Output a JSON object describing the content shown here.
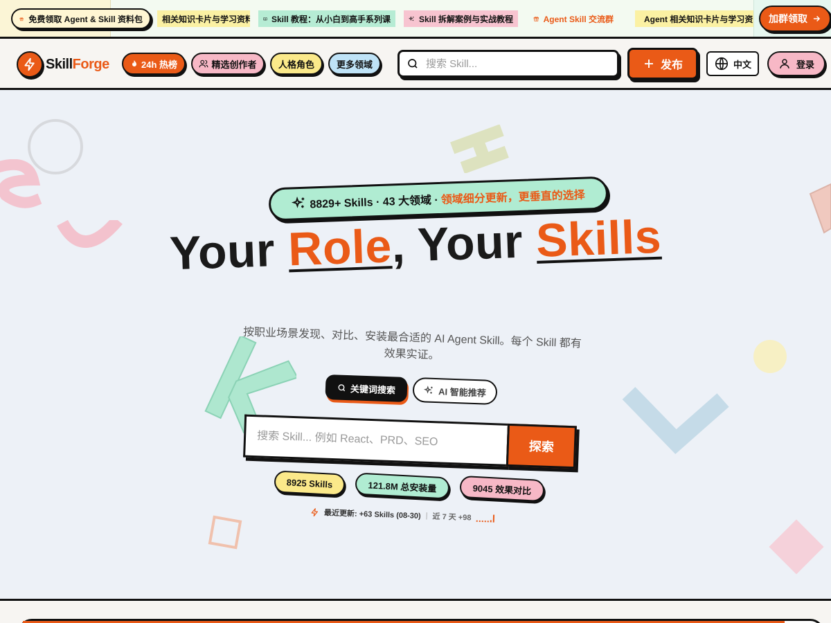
{
  "announcement": {
    "free_label": "免费领取 Agent & Skill 资料包",
    "items": [
      {
        "label": "相关知识卡片与学习资料",
        "icon": "none",
        "bg": "#fbf1a3",
        "color": "#111111"
      },
      {
        "label": "Skill 教程：从小白到高手系列课",
        "icon": "book-icon",
        "bg": "#b6ecd4",
        "color": "#111111"
      },
      {
        "label": "Skill 拆解案例与实战教程",
        "icon": "sparkles-icon",
        "bg": "#f7c4d0",
        "color": "#111111"
      },
      {
        "label": "Agent Skill 交流群",
        "icon": "gift-icon",
        "bg": "transparent",
        "color": "#ea5a17"
      },
      {
        "label": "Agent 相关知识卡片与学习资",
        "icon": "gift-icon",
        "bg": "#fbf1a3",
        "color": "#111111"
      }
    ],
    "cta_label": "加群领取"
  },
  "header": {
    "logo_part1": "Skill",
    "logo_part2": "Forge",
    "nav": [
      {
        "label": "24h 热榜",
        "icon": "fire-icon"
      },
      {
        "label": "精选创作者",
        "icon": "users-icon"
      },
      {
        "label": "人格角色",
        "icon": "none"
      },
      {
        "label": "更多领域",
        "icon": "none"
      }
    ],
    "search_placeholder": "搜索 Skill...",
    "publish_label": "发布",
    "lang_label": "中文",
    "login_label": "登录"
  },
  "hero": {
    "badge_main": "8829+ Skills · 43 大领域 · ",
    "badge_highlight": "领域细分更新，更垂直的选择",
    "title": {
      "p1": "Your ",
      "accent1": "Role",
      "p2": ", Your ",
      "accent2": "Skills"
    },
    "subtitle": "按职业场景发现、对比、安装最合适的 AI Agent Skill。每个 Skill 都有效果实证。",
    "tabs": {
      "keyword": "关键词搜索",
      "ai": "AI 智能推荐"
    },
    "search_placeholder": "搜索 Skill... 例如 React、PRD、SEO",
    "search_button": "探索",
    "stats": [
      {
        "label": "8925 Skills",
        "bg": "#fbe98a"
      },
      {
        "label": "121.8M 总安装量",
        "bg": "#b0ecd2"
      },
      {
        "label": "9045 效果对比",
        "bg": "#f7b8c6"
      }
    ],
    "updated": {
      "label": "最近更新: +63 Skills (08-30)",
      "separator": "|",
      "week": "近 7 天 +98"
    },
    "sparkline": [
      2,
      2,
      2,
      2,
      2,
      3,
      10
    ]
  },
  "colors": {
    "accent": "#ea5a17",
    "dark": "#111111",
    "mint": "#b0ecd2",
    "pink": "#f7b8c6",
    "yellow": "#fbe98a",
    "blue": "#bfe3f7"
  }
}
